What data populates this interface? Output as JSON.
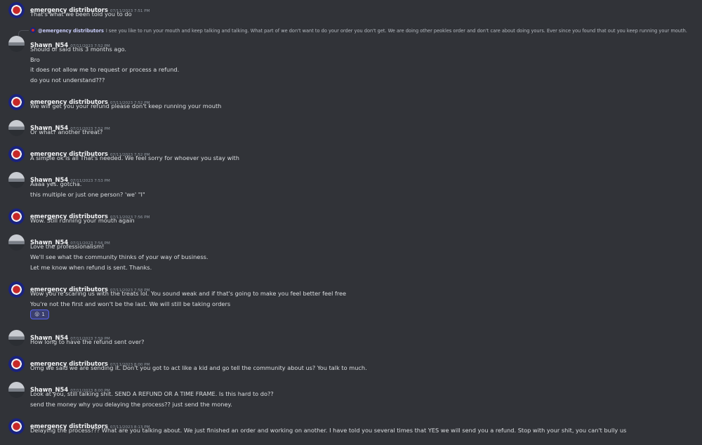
{
  "messages": [
    {
      "author": "emergency distributors",
      "time": "07/11/2023 7:51 PM",
      "lines": [
        "That's what we been told you to do"
      ]
    },
    {
      "author": "Shawn_N54",
      "time": "07/11/2023 7:52 PM",
      "reply": {
        "name": "@emergency distributors",
        "text": "I see you like to run your mouth and keep talking and talking. What part of we don't want to do your order you don't get. We are doing other peokles order and don't care about doing yours. Ever since you found that out you keep running your mouth."
      },
      "lines": [
        "Should of said this 3 months ago.",
        "Bro",
        "it does not allow me to request or process a refund.",
        "do you not understand???"
      ]
    },
    {
      "author": "emergency distributors",
      "time": "07/11/2023 7:52 PM",
      "lines": [
        "We will get you your refund please don't keep running your mouth"
      ]
    },
    {
      "author": "Shawn_N54",
      "time": "07/11/2023 7:52 PM",
      "lines": [
        "Or what? another threat?"
      ]
    },
    {
      "author": "emergency distributors",
      "time": "07/11/2023 7:52 PM",
      "lines": [
        "A simple ok is all That's needed. We feel sorry for whoever you stay with"
      ]
    },
    {
      "author": "Shawn_N54",
      "time": "07/11/2023 7:53 PM",
      "lines": [
        "Aaaa yes. gotcha.",
        "this multiple or just one person? 'we' \"I\""
      ]
    },
    {
      "author": "emergency distributors",
      "time": "07/11/2023 7:56 PM",
      "lines": [
        "Wow. Still running your mouth again"
      ]
    },
    {
      "author": "Shawn_N54",
      "time": "07/11/2023 7:56 PM",
      "lines": [
        "Love the professionalism!",
        "We'll see what the community thinks of your way of business.",
        "Let me know when refund is sent. Thanks."
      ]
    },
    {
      "author": "emergency distributors",
      "time": "07/11/2023 7:58 PM",
      "lines": [
        "Wow you're scaring us with the treats lol. You sound weak and if that's going to make you feel better feel free",
        "You're not the first and won't be the last.  We will still be taking orders"
      ],
      "reaction": {
        "emoji": "😮",
        "count": "1"
      }
    },
    {
      "author": "Shawn_N54",
      "time": "07/11/2023 7:59 PM",
      "lines": [
        "How long to have the refund sent over?"
      ]
    },
    {
      "author": "emergency distributors",
      "time": "07/11/2023 8:00 PM",
      "lines": [
        "Omg we said we are sending it. Don't you got to act like a kid and go tell the community about us? You talk to much."
      ]
    },
    {
      "author": "Shawn_N54",
      "time": "07/11/2023 8:00 PM",
      "lines": [
        "Look at you, still talking shit. SEND A REFUND OR A TIME FRAME. Is this hard to do??",
        "send the money why you delaying the process?? just send the money."
      ]
    },
    {
      "author": "emergency distributors",
      "time": "07/11/2023 8:13 PM",
      "lines": [
        "Delaying the process??? What are you talking about. We just finished an order and working on another. I have told you several times that YES we will send you a refund. Stop with your shit,  you can't bully us"
      ]
    }
  ]
}
